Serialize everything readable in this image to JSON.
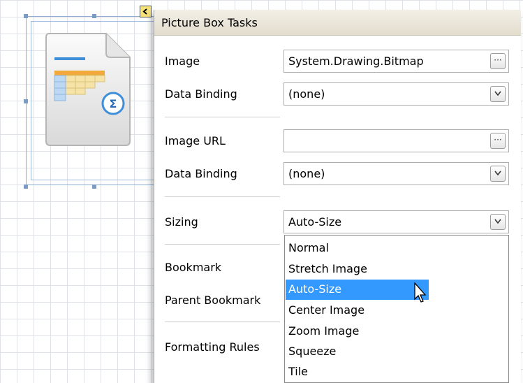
{
  "panel": {
    "title": "Picture Box Tasks",
    "rows": {
      "image": {
        "label": "Image",
        "value": "System.Drawing.Bitmap",
        "button": "ellipsis-icon"
      },
      "image_binding": {
        "label": "Data Binding",
        "value": "(none)",
        "button": "chevron-down-icon"
      },
      "image_url": {
        "label": "Image URL",
        "value": "",
        "button": "ellipsis-icon"
      },
      "url_binding": {
        "label": "Data Binding",
        "value": "(none)",
        "button": "chevron-down-icon"
      },
      "sizing": {
        "label": "Sizing",
        "value": "Auto-Size",
        "button": "chevron-down-icon"
      },
      "bookmark": {
        "label": "Bookmark"
      },
      "parent_bookmark": {
        "label": "Parent Bookmark"
      },
      "formatting_rules": {
        "label": "Formatting Rules"
      }
    },
    "sizing_options": [
      "Normal",
      "Stretch Image",
      "Auto-Size",
      "Center Image",
      "Zoom Image",
      "Squeeze",
      "Tile"
    ],
    "sizing_selected": "Auto-Size"
  },
  "designer": {
    "smart_tag_icon": "chevron-left-icon",
    "placeholder_icon": "spreadsheet-sum-icon"
  },
  "colors": {
    "selection": "#3399ff",
    "header_top": "#f3efe6",
    "header_bottom": "#e3ddce"
  }
}
